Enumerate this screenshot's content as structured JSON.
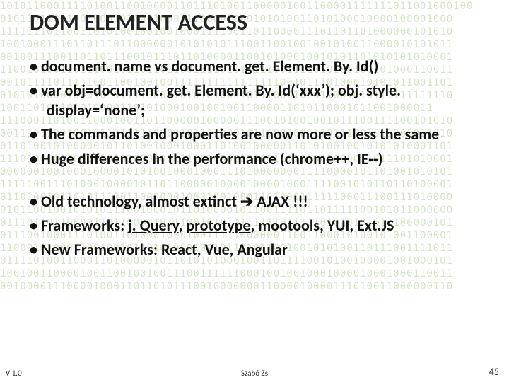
{
  "title": "DOM ELEMENT ACCESS",
  "bullets_top": [
    "document. name vs document. get. Element. By. Id()",
    "var obj=document. get. Element. By. Id(‘xxx’); obj. style. display=‘none’;",
    "The commands and properties are now more or less the same",
    "Huge differences in the performance (chrome++, IE--)"
  ],
  "bullets_bottom": {
    "line1_pre": "Old technology, almost extinct ",
    "line1_post": " AJAX !!!",
    "line2_pre": "Frameworks: ",
    "fw1": "j. Query",
    "fw_sep1": ", ",
    "fw2": "prototype",
    "fw_rest": ", mootools, YUI, Ext.JS",
    "line3": "New Frameworks: React, Vue, Angular"
  },
  "footer": {
    "left": "V 1.0",
    "center": "Szabó Zs",
    "right": "45"
  },
  "bg": "10101100011110100110010000110111010011000001001100001111111011001000100\n01011011001001000101000100011100001000101010011010100010000100001000\n11111110110011010100100100100011110011011000011101101101000000101010\n10010001110110111011000000101010101110011001001001010011000010101011\n00100111001101101110010111011010000110010100010010101101010101010001\n11001010011011100101101101100111101011111001111010100100101000110011\n00101111011111001100100100111111111111111100101110100010101011001101\n01010100001000101011110001101010100010111000101011001010111111111110\n10011010110101000011010100010010010011000011010110001011001000011\n11100011010011000100110110000010000011100101001001011100111100101010\n00111011001001011011111000010111100010110001001110111001011000011010\n01101001010000010110100100010001101001000001101010010010101010001101\n11101000011011010101000100111101000010000110101001000011011101010001\n00000010010001000010101001000100011101000000011110000101101001010101\n11111001110100010000101101100000100001000010001111001010110110100001\n01101001011010111001100000010001001000110100011111100011100111010000\n01011001001010101110010001011010000101100111101101111100101011000000\n01110110110000110110000101110010101111111101111101010101011100000101\n01110010001110100110100010001001111100000011001100010100101001100001\n11000101000110010010110101000100101101011001001010100110111001111011\n01111010011000110100000101101010100010011011110010100100001001000101\n10010011000010011001001001110011111100010010010001000010001000110011\n00100001110000100011011010111001000000011000010000111010011000000110"
}
